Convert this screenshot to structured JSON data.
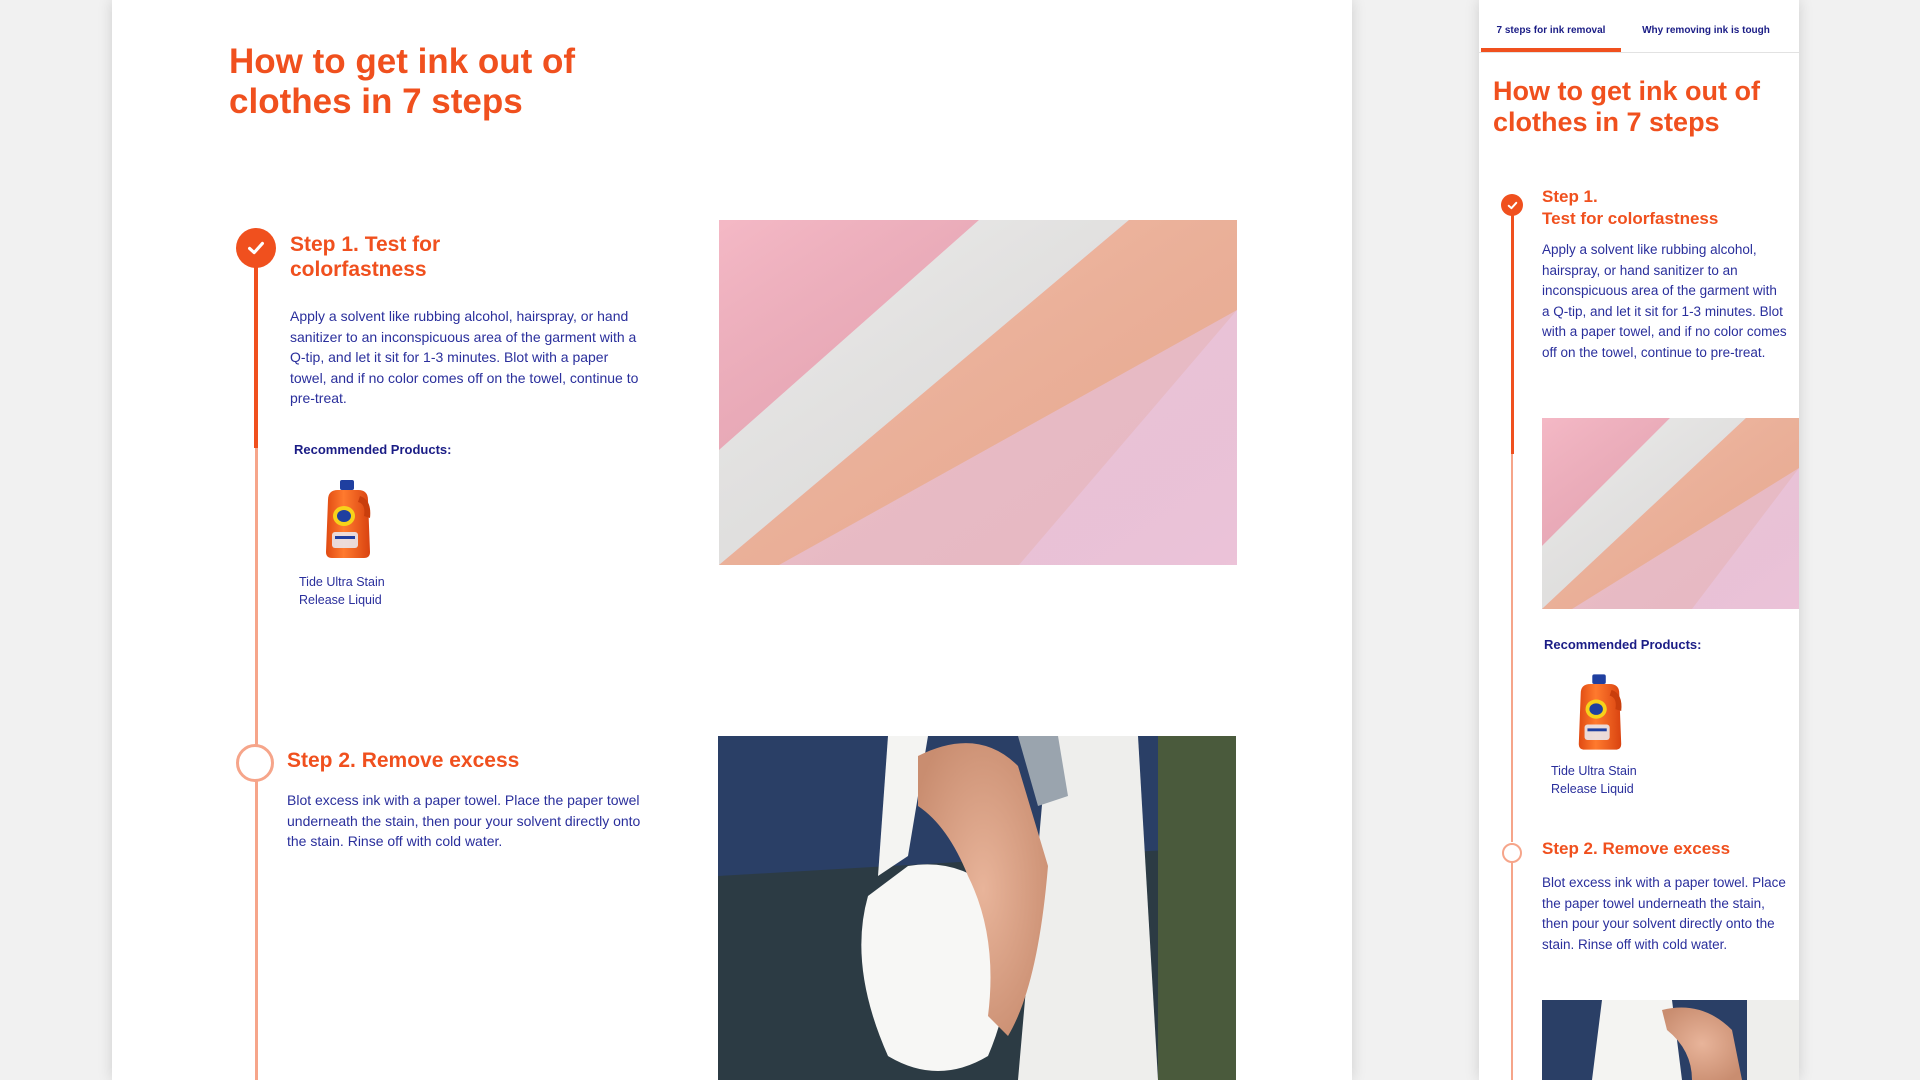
{
  "title": "How to get ink out of clothes in 7 steps",
  "tabs": [
    {
      "label": "7 steps for ink removal",
      "active": true
    },
    {
      "label": "Why removing ink is tough",
      "active": false
    }
  ],
  "steps": [
    {
      "title": "Step 1. Test for colorfastness",
      "number": "Step 1.",
      "name": "Test for colorfastness",
      "body": "Apply a solvent like rubbing alcohol, hairspray, or hand sanitizer to an inconspicuous area of the garment with a Q-tip, and let it sit for 1-3 minutes. Blot with a paper towel, and if no color comes off on the towel, continue to pre-treat.",
      "status": "completed",
      "image": "pastel-fabric-photo",
      "recommended_label": "Recommended Products:",
      "product": {
        "name": "Tide Ultra Stain Release Liquid",
        "icon": "detergent-bottle-icon"
      }
    },
    {
      "title": "Step 2. Remove excess",
      "body": "Blot excess ink with a paper towel. Place the paper towel underneath the stain, then pour your solvent directly onto the stain. Rinse off with cold water.",
      "status": "pending",
      "image": "paper-towel-blotting-photo"
    }
  ],
  "colors": {
    "accent": "#f0501e",
    "timeline_light": "#f6a58a",
    "text": "#2a2f9c",
    "label": "#1b1d86",
    "background": "#f1f1f1"
  }
}
